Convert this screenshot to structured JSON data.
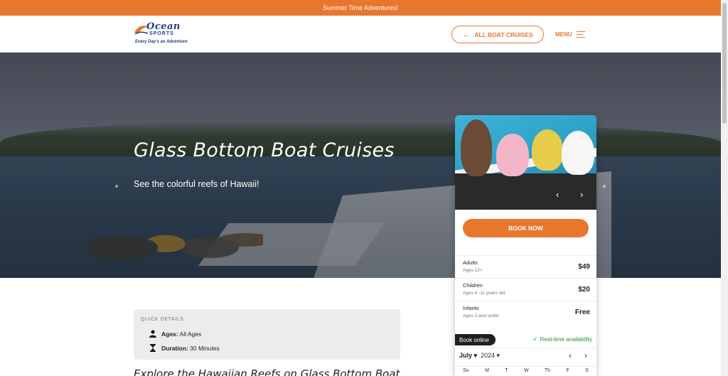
{
  "announcement": "Summer Time Adventures!",
  "logo": {
    "line1": "Ocean",
    "line2": "SPORTS",
    "tagline": "Every Day's an Adventure"
  },
  "header": {
    "all_boats_label": "ALL BOAT CRUISES",
    "menu_label": "MENU"
  },
  "hero": {
    "title": "Glass Bottom Boat Cruises",
    "subtitle": "See the colorful reefs of Hawaii!"
  },
  "booking": {
    "book_label": "BOOK NOW",
    "prices": [
      {
        "name": "Adults",
        "ages": "Ages 12+",
        "price": "$49"
      },
      {
        "name": "Children",
        "ages": "Ages 4 -11 years old",
        "price": "$20"
      },
      {
        "name": "Infants",
        "ages": "Ages 3 and under",
        "price": "Free"
      }
    ],
    "online_label": "Book online",
    "realtime_label": "Real-time availability",
    "calendar": {
      "month": "July",
      "year": "2024",
      "weekdays": [
        "Su",
        "M",
        "T",
        "W",
        "Th",
        "F",
        "S"
      ]
    }
  },
  "quick_details": {
    "label": "QUICK DETAILS",
    "ages_key": "Ages:",
    "ages_val": "All Ages",
    "duration_key": "Duration:",
    "duration_val": "30 Minutes"
  },
  "explore_heading": "Explore the Hawaiian Reefs on Glass Bottom Boat",
  "colors": {
    "accent": "#e8772e",
    "brand_blue": "#1d3e86",
    "success": "#2e8b3a"
  }
}
